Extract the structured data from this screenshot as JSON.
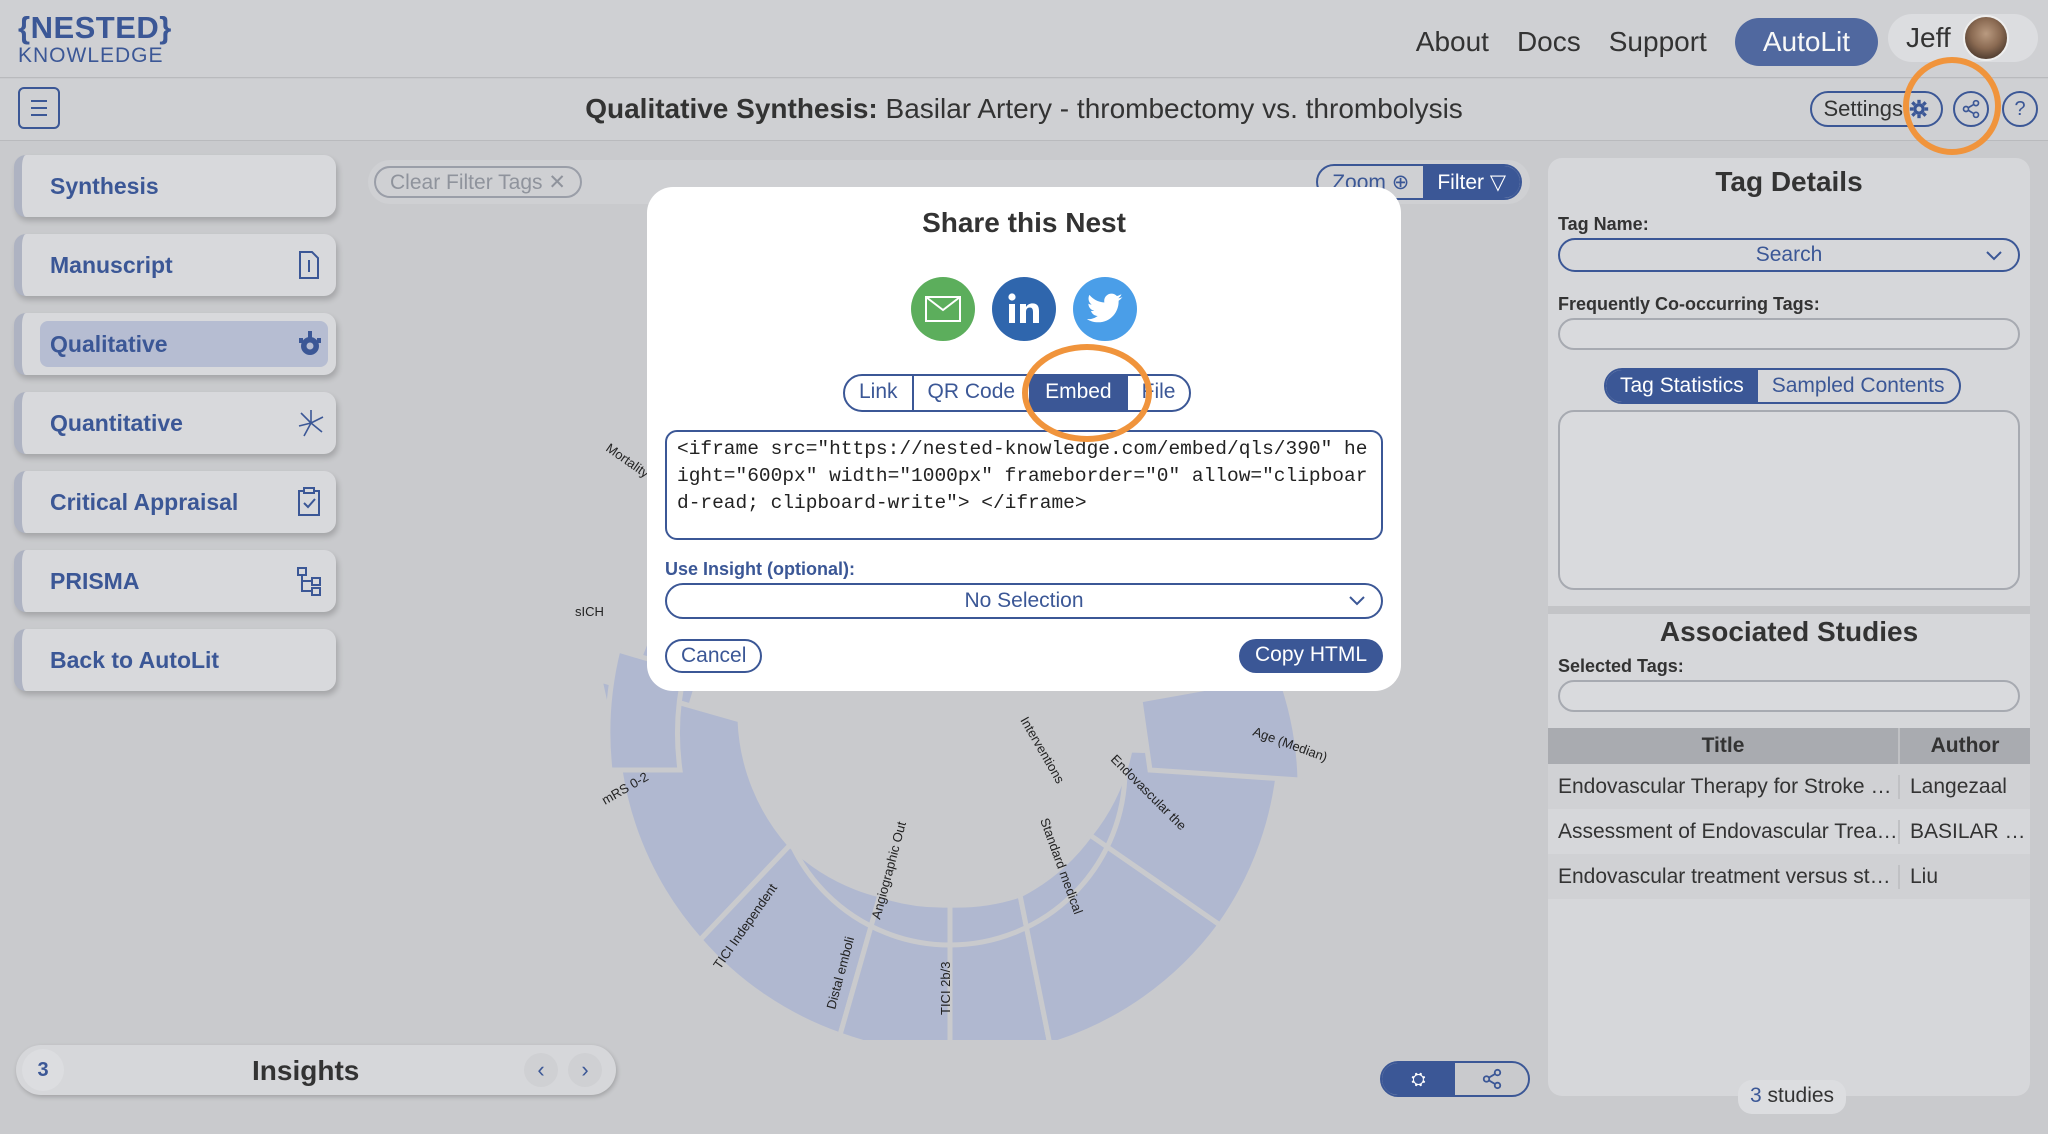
{
  "app": {
    "logo_line1": "{NESTED}",
    "logo_line2": "KNOWLEDGE"
  },
  "nav": {
    "about": "About",
    "docs": "Docs",
    "support": "Support",
    "autolit": "AutoLit",
    "user_name": "Jeff"
  },
  "header": {
    "title_bold": "Qualitative Synthesis:",
    "title_rest": " Basilar Artery - thrombectomy vs. thrombolysis",
    "settings_label": "Settings"
  },
  "sidebar": {
    "items": [
      {
        "label": "Synthesis",
        "icon": "none"
      },
      {
        "label": "Manuscript",
        "icon": "document-icon"
      },
      {
        "label": "Qualitative",
        "icon": "qualitative-icon",
        "active": true
      },
      {
        "label": "Quantitative",
        "icon": "burst-icon"
      },
      {
        "label": "Critical Appraisal",
        "icon": "clipboard-icon"
      },
      {
        "label": "PRISMA",
        "icon": "flowchart-icon"
      },
      {
        "label": "Back to AutoLit",
        "icon": "none"
      }
    ]
  },
  "insights": {
    "count": "3",
    "title": "Insights"
  },
  "filterbar": {
    "clear_label": "Clear Filter Tags",
    "zoom_label": "Zoom",
    "filter_label": "Filter"
  },
  "sunburst_labels": {
    "mortality": "Mortality",
    "sich": "sICH",
    "mrs": "mRS 0-2",
    "tici_ind": "TICI Independent",
    "distal": "Distal emboli",
    "tici23": "TICI 2b/3",
    "angio": "Angiographic Out",
    "interventions": "Interventions",
    "endovascular": "Endovascular the",
    "standard": "Standard medical",
    "age": "Age (Median)"
  },
  "tag_details": {
    "title": "Tag Details",
    "tag_name_label": "Tag Name:",
    "tag_name_value": "Search",
    "cooccurring_label": "Frequently Co-occurring Tags:",
    "tab_stats": "Tag Statistics",
    "tab_samples": "Sampled Contents",
    "assoc_title": "Associated Studies",
    "selected_tags_label": "Selected Tags:",
    "columns": [
      "Title",
      "Author"
    ],
    "rows": [
      {
        "title": "Endovascular Therapy for Stroke Due to Basilar-Artery Occlusion",
        "author": "Langezaal"
      },
      {
        "title": "Assessment of Endovascular Treatment for Acute Basilar Artery Occlusion",
        "author": "BASILAR Study Group"
      },
      {
        "title": "Endovascular treatment versus standard medical treatment",
        "author": "Liu"
      }
    ],
    "studies_count": "3",
    "studies_word": " studies"
  },
  "modal": {
    "title": "Share this Nest",
    "tabs": [
      "Link",
      "QR Code",
      "Embed",
      "File"
    ],
    "active_tab": "Embed",
    "embed_code": "<iframe src=\"https://nested-knowledge.com/embed/qls/390\" height=\"600px\" width=\"1000px\" frameborder=\"0\" allow=\"clipboard-read; clipboard-write\"> </iframe>",
    "insight_label": "Use Insight (optional):",
    "insight_value": "No Selection",
    "cancel_label": "Cancel",
    "copy_label": "Copy HTML",
    "social": [
      "email-icon",
      "linkedin-icon",
      "twitter-icon"
    ]
  },
  "colors": {
    "brand": "#3b5796",
    "highlight": "#f0943c",
    "email_green": "#5cae5c",
    "linkedin_blue": "#2f66ad",
    "twitter_blue": "#4a9ee8"
  }
}
